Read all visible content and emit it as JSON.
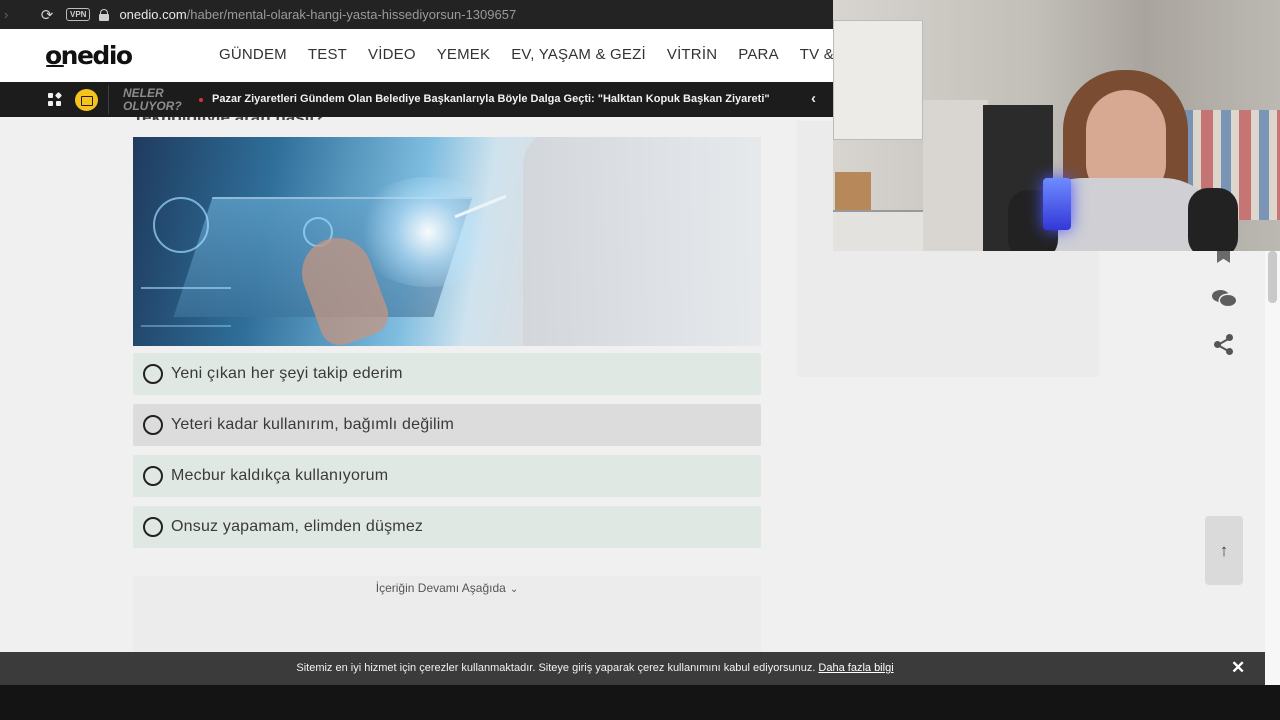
{
  "browser": {
    "vpn_label": "VPN",
    "url_host": "onedio.com",
    "url_path": "/haber/mental-olarak-hangi-yasta-hissediyorsun-1309657"
  },
  "site": {
    "logo": "onedio",
    "nav": [
      "GÜNDEM",
      "TEST",
      "VİDEO",
      "YEMEK",
      "EV, YAŞAM & GEZİ",
      "VİTRİN",
      "PARA",
      "TV & SİNE"
    ]
  },
  "ticker": {
    "label_line1": "NELER",
    "label_line2": "OLUYOR?",
    "headline": "Pazar Ziyaretleri Gündem Olan Belediye Başkanlarıyla Böyle Dalga Geçti: \"Halktan Kopuk Başkan Ziyareti\""
  },
  "quiz": {
    "partial_title": "Teknolojiyle aran nasıl?",
    "options": [
      "Yeni çıkan her şeyi takip ederim",
      "Yeteri kadar kullanırım, bağımlı değilim",
      "Mecbur kaldıkça kullanıyorum",
      "Onsuz yapamam, elimden düşmez"
    ],
    "continue_label": "İçeriğin Devamı Aşağıda"
  },
  "cookie": {
    "text": "Sitemiz en iyi hizmet için çerezler kullanmaktadır. Siteye giriş yaparak çerez kullanımını kabul ediyorsunuz.",
    "link": "Daha fazla bilgi",
    "close": "✕"
  },
  "icons": {
    "reload": "reload-icon",
    "lock": "lock-icon",
    "bookmark": "bookmark-icon",
    "comments": "comments-icon",
    "share": "share-icon",
    "scroll_top": "arrow-up-icon",
    "ticker_prev": "chevron-left-icon"
  },
  "colors": {
    "option_bg": "#e0e8e3",
    "option_hover_bg": "#dcdcdc",
    "ticker_bg": "#1c1c1c",
    "badge_yellow": "#f6c21c",
    "cookie_bg": "#3b3b3b"
  }
}
